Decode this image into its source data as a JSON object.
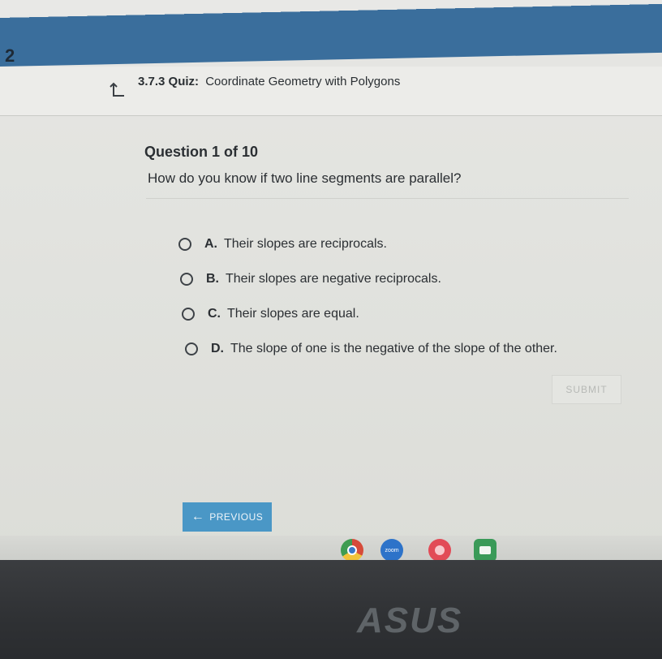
{
  "page_number": "2",
  "header": {
    "up_icon": "up-arrow-icon",
    "quiz_label": "3.7.3 Quiz:",
    "quiz_name": "Coordinate Geometry with Polygons"
  },
  "question": {
    "number": "Question 1 of 10",
    "text": "How do you know if two line segments are parallel?"
  },
  "options": [
    {
      "letter": "A.",
      "text": "Their slopes are reciprocals."
    },
    {
      "letter": "B.",
      "text": "Their slopes are negative reciprocals."
    },
    {
      "letter": "C.",
      "text": "Their slopes are equal."
    },
    {
      "letter": "D.",
      "text": "The slope of one is the negative of the slope of the other."
    }
  ],
  "buttons": {
    "submit": "SUBMIT",
    "previous": "PREVIOUS",
    "previous_icon": "left-arrow-icon"
  },
  "shelf": {
    "zoom_label": "zoom",
    "icons": [
      "chrome-icon",
      "zoom-icon",
      "photos-icon",
      "meet-icon"
    ]
  },
  "bezel": {
    "brand": "ASUS"
  }
}
